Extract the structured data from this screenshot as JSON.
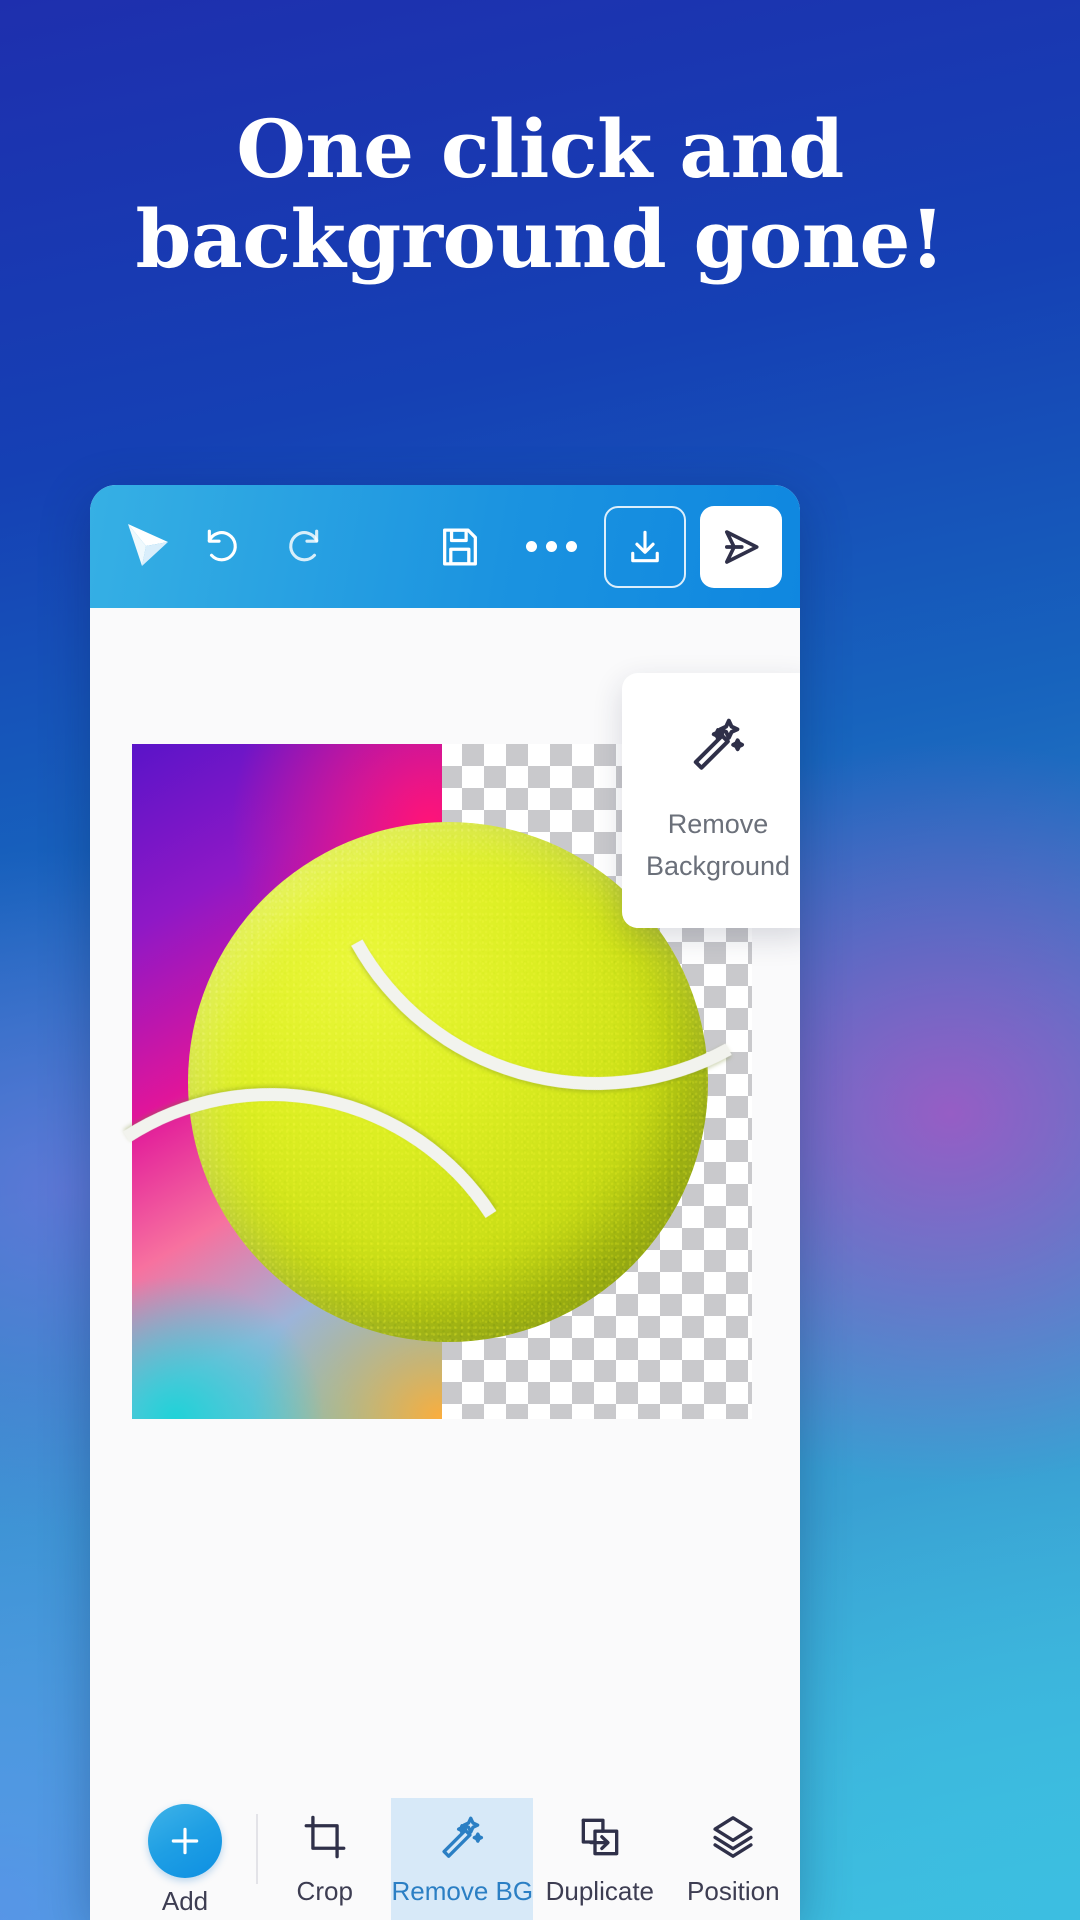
{
  "promo": {
    "headline_line1": "One click and",
    "headline_line2": "background gone!"
  },
  "app": {
    "toolbar": {
      "logo": "app-logo-arrow-icon",
      "undo_label": "Undo",
      "redo_label": "Redo",
      "save_label": "Save",
      "more_label": "More options",
      "download_label": "Download",
      "share_label": "Share"
    },
    "tooltip_card": {
      "icon": "magic-wand-icon",
      "line1": "Remove",
      "line2": "Background"
    },
    "bottom_toolbar": {
      "add_label": "Add",
      "add_glyph": "+",
      "tools": [
        {
          "label": "Crop",
          "icon": "crop-icon",
          "active": false
        },
        {
          "label": "Remove BG",
          "icon": "magic-wand-icon",
          "active": true
        },
        {
          "label": "Duplicate",
          "icon": "duplicate-icon",
          "active": false
        },
        {
          "label": "Position",
          "icon": "layers-icon",
          "active": false
        }
      ]
    },
    "canvas": {
      "subject": "tennis-ball",
      "background_state": "half-removed"
    }
  },
  "colors": {
    "page_gradient_start": "#1e2fae",
    "page_gradient_end": "#3fc0e0",
    "toolbar_blue": "#1b93e0",
    "accent_blue": "#2b7fc4",
    "active_tool_bg": "#d7e9f8",
    "icon_navy": "#2f3049",
    "card_text": "#6b707a",
    "ball_yellow": "#dcee22"
  }
}
